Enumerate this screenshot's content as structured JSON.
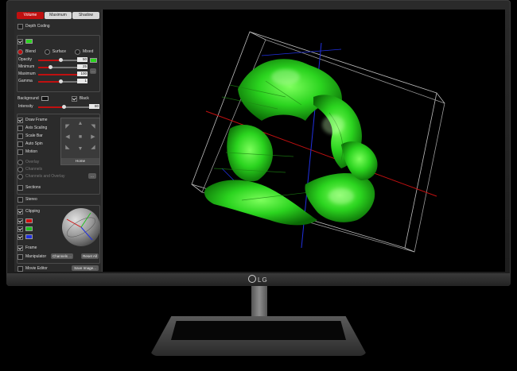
{
  "tabs": [
    "Volume",
    "Maximum",
    "Shadow"
  ],
  "depth_coding": "Depth Coding",
  "render_modes": [
    "Blend",
    "Surface",
    "Mixed"
  ],
  "sliders": [
    {
      "label": "Opacity",
      "value": "50",
      "level": 0.5
    },
    {
      "label": "Minimum",
      "value": "25",
      "level": 0.25
    },
    {
      "label": "Maximum",
      "value": "100",
      "level": 1.0
    },
    {
      "label": "Gamma",
      "value": "1",
      "level": 0.5
    }
  ],
  "background": {
    "label": "Background",
    "black_label": "Black"
  },
  "intensity": {
    "label": "Intensity",
    "value": "80"
  },
  "display_options": [
    "Draw Frame",
    "Axis Scaling",
    "Scale Bar",
    "Auto Spin",
    "Motion"
  ],
  "display_checked": [
    true,
    false,
    false,
    false,
    false
  ],
  "home_label": "Home",
  "overlay_options": [
    "Overlay",
    "Channels",
    "Channels and Overlay"
  ],
  "sections_label": "Sections",
  "stereo_label": "Stereo",
  "clipping_label": "Clipping",
  "frame_label": "Frame",
  "manipulator_label": "Manipulator",
  "channels_button": "Channels ...",
  "reset_all_button": "Reset All",
  "movie_editor_label": "Movie Editor",
  "save_image_button": "Save Image...",
  "brand": "LG",
  "colors": {
    "accent": "#c01010",
    "volume_green": "#2bd41f",
    "panel_bg": "#2b2b2b"
  }
}
